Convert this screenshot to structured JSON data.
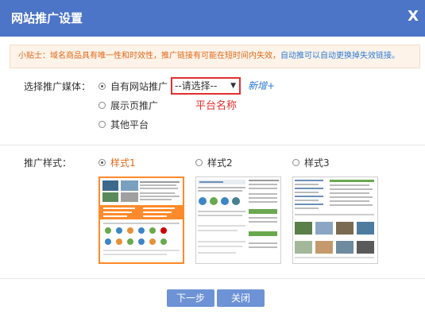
{
  "dialog": {
    "title": "网站推广设置",
    "close_label": "X"
  },
  "tip": {
    "prefix": "小贴士：域名商品具有唯一性和时效性，推广链接有可能在短时间内失效，",
    "highlight": "自动推可以自动更换掉失效链接。"
  },
  "media": {
    "label": "选择推广媒体：",
    "options": [
      "自有网站推广",
      "展示页推广",
      "其他平台"
    ],
    "selected_index": 0,
    "select_value": "--请选择--",
    "select_hint": "平台名称",
    "new_link": "新增+"
  },
  "style": {
    "label": "推广样式：",
    "options": [
      "样式1",
      "样式2",
      "样式3"
    ],
    "selected_index": 0
  },
  "buttons": {
    "next": "下一步",
    "close": "关闭"
  },
  "colors": {
    "titlebar": "#4c74c7",
    "accent_orange": "#e06a1b",
    "link_blue": "#2f7bd5",
    "highlight_red": "#e03030",
    "button_blue": "#6d93d6"
  }
}
